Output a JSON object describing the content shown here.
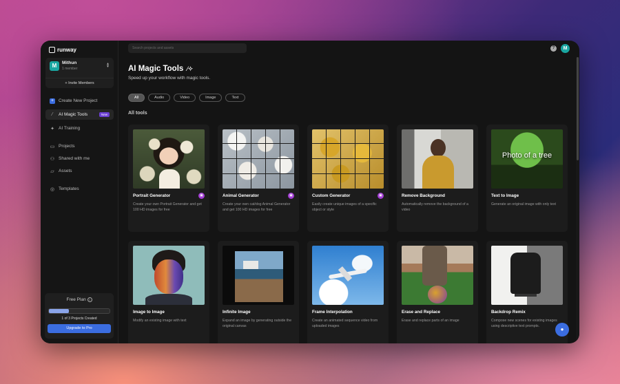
{
  "app": {
    "logo_text": "runway"
  },
  "team": {
    "initial": "M",
    "name": "Mithun",
    "members": "1 member",
    "invite_label": "+ Invite Members"
  },
  "nav": {
    "create": "Create New Project",
    "magic": "AI Magic Tools",
    "new_badge": "New",
    "training": "AI Training",
    "projects": "Projects",
    "shared": "Shared with me",
    "assets": "Assets",
    "templates": "Templates"
  },
  "plan": {
    "title": "Free Plan",
    "count_text": "1 of 3 Projects Created",
    "progress": 0.33,
    "upgrade_label": "Upgrade to Pro"
  },
  "search": {
    "placeholder": "Search projects and assets"
  },
  "user": {
    "initial": "M"
  },
  "page": {
    "title": "AI Magic Tools",
    "subtitle": "Speed up your workflow with magic tools.",
    "section": "All tools"
  },
  "filters": [
    "All",
    "Audio",
    "Video",
    "Image",
    "Text"
  ],
  "tools": [
    {
      "title": "Portrait Generator",
      "desc": "Create your own Portrait Generator and get 100 HD images for free",
      "locked": true
    },
    {
      "title": "Animal Generator",
      "desc": "Create your own cat/dog Animal Generator and get 100 HD images for free",
      "locked": true
    },
    {
      "title": "Custom Generator",
      "desc": "Easily create unique images of a specific object or style",
      "locked": true
    },
    {
      "title": "Remove Background",
      "desc": "Automatically remove the background of a video",
      "locked": false
    },
    {
      "title": "Text to Image",
      "desc": "Generate an original image with only text",
      "locked": false,
      "image_text": "Photo of a tree"
    },
    {
      "title": "Image to Image",
      "desc": "Modify an existing image with text",
      "locked": false
    },
    {
      "title": "Infinite Image",
      "desc": "Expand an image by generating outside the original canvas",
      "locked": false
    },
    {
      "title": "Frame Interpolation",
      "desc": "Create an animated sequence video from uploaded images",
      "locked": false
    },
    {
      "title": "Erase and Replace",
      "desc": "Erase and replace parts of an image",
      "locked": false
    },
    {
      "title": "Backdrop Remix",
      "desc": "Compose new scenes for existing images using descriptive text prompts.",
      "locked": false
    }
  ],
  "colors": {
    "accent": "#3b6de0",
    "lock": "#a23cd4",
    "badge": "#6b3fd4",
    "avatar": "#1aa6a1"
  }
}
